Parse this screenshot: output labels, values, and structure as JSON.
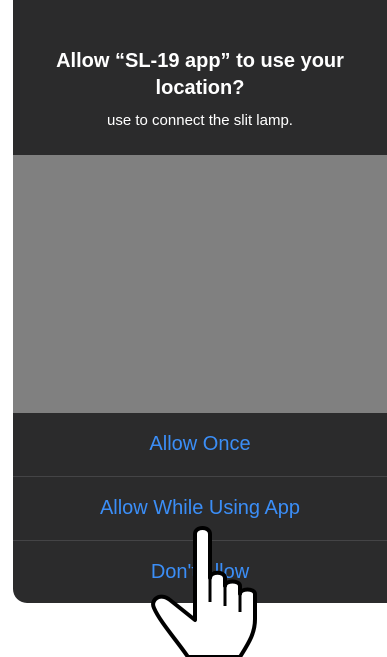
{
  "alert": {
    "title": "Allow “SL-19 app” to use your location?",
    "subtitle": "use to connect the slit lamp."
  },
  "buttons": {
    "allow_once": "Allow Once",
    "allow_while_using": "Allow While Using App",
    "dont_allow": "Don't Allow"
  },
  "colors": {
    "alert_background": "#2b2b2c",
    "map_placeholder": "#808080",
    "button_text": "#3b8ef7"
  },
  "icons": {
    "pointer": "hand-pointer-icon"
  }
}
